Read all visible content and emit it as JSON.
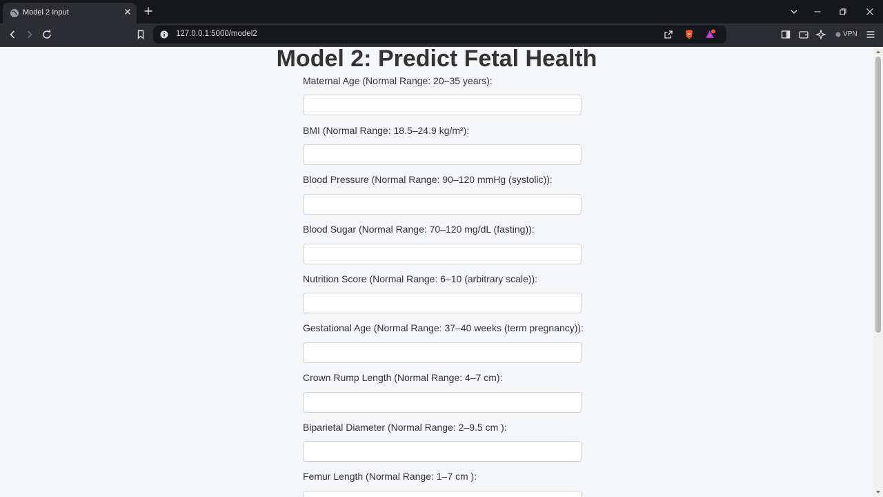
{
  "browser": {
    "tab_title": "Model 2 Input",
    "url": "127.0.0.1:5000/model2",
    "vpn_label": "VPN"
  },
  "page": {
    "title": "Model 2: Predict Fetal Health",
    "fields": [
      {
        "label": "Maternal Age (Normal Range: 20–35 years):",
        "value": ""
      },
      {
        "label": "BMI (Normal Range: 18.5–24.9 kg/m²):",
        "value": ""
      },
      {
        "label": "Blood Pressure (Normal Range: 90–120 mmHg (systolic)):",
        "value": ""
      },
      {
        "label": "Blood Sugar (Normal Range: 70–120 mg/dL (fasting)):",
        "value": ""
      },
      {
        "label": "Nutrition Score (Normal Range: 6–10 (arbitrary scale)):",
        "value": ""
      },
      {
        "label": "Gestational Age (Normal Range: 37–40 weeks (term pregnancy)):",
        "value": ""
      },
      {
        "label": "Crown Rump Length (Normal Range: 4–7 cm):",
        "value": ""
      },
      {
        "label": "Biparietal Diameter (Normal Range: 2–9.5 cm ):",
        "value": ""
      },
      {
        "label": "Femur Length (Normal Range: 1–7 cm ):",
        "value": ""
      }
    ]
  },
  "colors": {
    "page_background": "#f4f6f9",
    "title_text": "#333333",
    "chrome_dark": "#16171b",
    "chrome_toolbar": "#2b2d33"
  }
}
